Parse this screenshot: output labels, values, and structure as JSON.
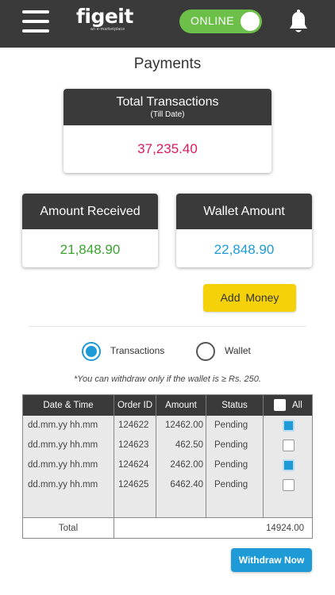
{
  "header": {
    "menu_icon": "hamburger-menu-icon",
    "logo": {
      "main": "figeit",
      "tagline": "an e-marketplace"
    },
    "status_toggle": {
      "label": "ONLINE",
      "state": "on",
      "color": "#6cc04a"
    },
    "notification_icon": "bell-icon"
  },
  "page": {
    "title": "Payments"
  },
  "summary": {
    "total": {
      "title": "Total Transactions",
      "subtitle": "(Till Date)",
      "value": "37,235.40",
      "color": "#d81b60"
    },
    "received": {
      "title": "Amount Received",
      "value": "21,848.90",
      "color": "#3aa32e"
    },
    "wallet": {
      "title": "Wallet Amount",
      "value": "22,848.90",
      "color": "#1e9bd7"
    }
  },
  "actions": {
    "add_money": "Add  Money",
    "withdraw": "Withdraw Now"
  },
  "view_toggle": {
    "options": [
      {
        "label": "Transactions",
        "selected": true
      },
      {
        "label": "Wallet",
        "selected": false
      }
    ]
  },
  "note": "*You can withdraw only if the wallet is ≥ Rs. 250.",
  "table": {
    "headers": {
      "datetime": "Date & Time",
      "order_id": "Order ID",
      "amount": "Amount",
      "status": "Status",
      "all": "All"
    },
    "rows": [
      {
        "datetime": "dd.mm.yy  hh.mm",
        "order_id": "124622",
        "amount": "12462.00",
        "status": "Pending",
        "checked": true
      },
      {
        "datetime": "dd.mm.yy  hh.mm",
        "order_id": "124623",
        "amount": "462.50",
        "status": "Pending",
        "checked": false
      },
      {
        "datetime": "dd.mm.yy  hh.mm",
        "order_id": "124624",
        "amount": "2462.00",
        "status": "Pending",
        "checked": true
      },
      {
        "datetime": "dd.mm.yy  hh.mm",
        "order_id": "124625",
        "amount": "6462.40",
        "status": "Pending",
        "checked": false
      }
    ],
    "footer": {
      "label": "Total",
      "value": "14924.00"
    }
  },
  "colors": {
    "header_bg": "#3a3a3a",
    "accent_blue": "#1e9bd7",
    "add_money_bg": "#f5d10a"
  }
}
